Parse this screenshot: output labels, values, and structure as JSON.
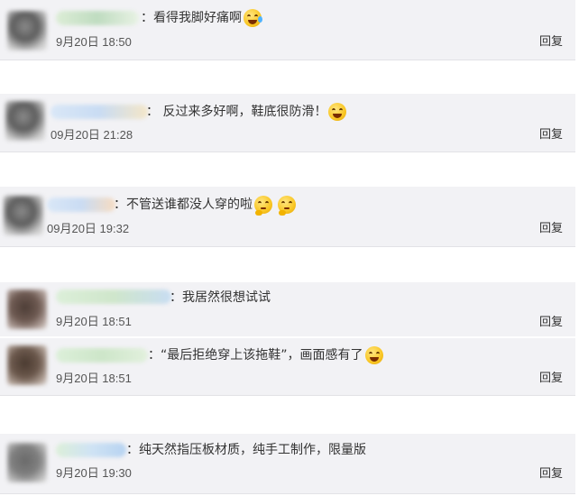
{
  "reply_label": "回复",
  "comments": [
    {
      "text": "：看得我脚好痛啊",
      "emoji": [
        "cry-laugh-emoji"
      ],
      "time": "9月20日 18:50",
      "username_color": "#cfe6c6"
    },
    {
      "text": "： 反过来多好啊，鞋底很防滑！",
      "emoji": [
        "laugh-emoji"
      ],
      "time": "09月20日 21:28",
      "username_color": "#d6e6f8"
    },
    {
      "text": "：不管送谁都没人穿的啦",
      "emoji": [
        "thinking-emoji",
        "thinking-emoji"
      ],
      "time": "09月20日 19:32",
      "username_color": "#d6e6f8"
    },
    {
      "text": "：我居然很想试试",
      "emoji": [],
      "time": "9月20日 18:51",
      "username_color": "#d7ecd4"
    },
    {
      "text": "：“最后拒绝穿上该拖鞋”，画面感有了",
      "emoji": [
        "laugh-emoji"
      ],
      "time": "9月20日 18:51",
      "username_color": "#d7ecd4"
    },
    {
      "text": "：纯天然指压板材质，纯手工制作，限量版",
      "emoji": [],
      "time": "9月20日 19:30",
      "username_color": "#d3e4f5"
    }
  ]
}
